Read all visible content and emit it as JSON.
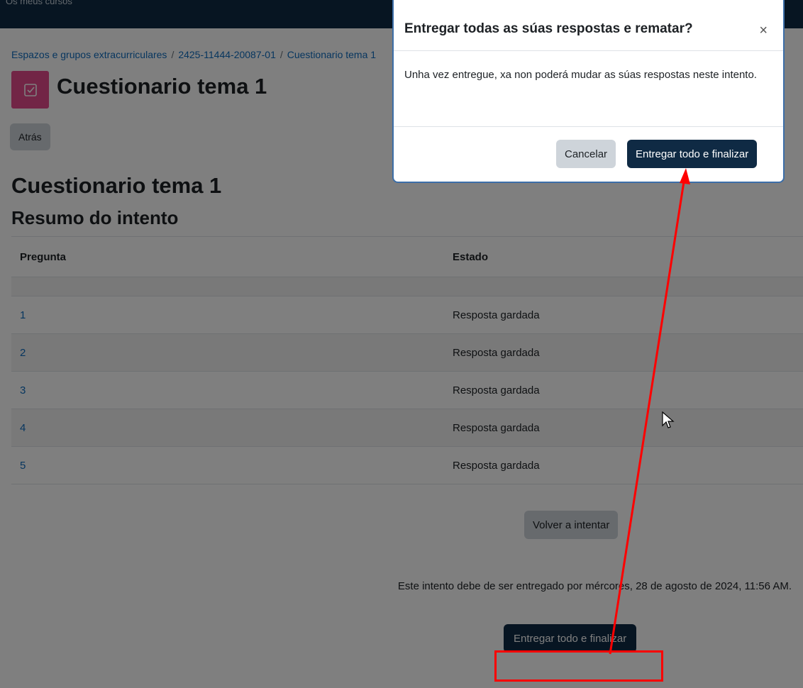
{
  "navbar": {
    "partial_text": "Os meus cursos"
  },
  "breadcrumb": {
    "items": [
      "Espazos e grupos extracurriculares",
      "2425-11444-20087-01",
      "Cuestionario tema 1"
    ]
  },
  "page": {
    "title": "Cuestionario tema 1",
    "back_label": "Atrás",
    "heading": "Cuestionario tema 1",
    "subheading": "Resumo do intento"
  },
  "summary_table": {
    "headers": [
      "Pregunta",
      "Estado"
    ],
    "rows": [
      {
        "question": "1",
        "status": "Resposta gardada"
      },
      {
        "question": "2",
        "status": "Resposta gardada"
      },
      {
        "question": "3",
        "status": "Resposta gardada"
      },
      {
        "question": "4",
        "status": "Resposta gardada"
      },
      {
        "question": "5",
        "status": "Resposta gardada"
      }
    ]
  },
  "retry_label": "Volver a intentar",
  "due_text": "Este intento debe de ser entregado por mércores, 28 de agosto de 2024, 11:56 AM.",
  "submit_label": "Entregar todo e finalizar",
  "modal": {
    "title": "Entregar todas as súas respostas e rematar?",
    "close_glyph": "×",
    "body": "Unha vez entregue, xa non poderá mudar as súas respostas neste intento.",
    "cancel_label": "Cancelar",
    "confirm_label": "Entregar todo e finalizar"
  },
  "colors": {
    "navbar": "#0f2a44",
    "primary_button": "#0f2a44",
    "secondary_button": "#ced4da",
    "link": "#0f6cbf",
    "activity_icon": "#e44b8d",
    "annotation": "#ff0000"
  },
  "icons": {
    "activity": "quiz-checkbox-icon",
    "close": "close-icon",
    "cursor": "mouse-pointer-icon"
  }
}
